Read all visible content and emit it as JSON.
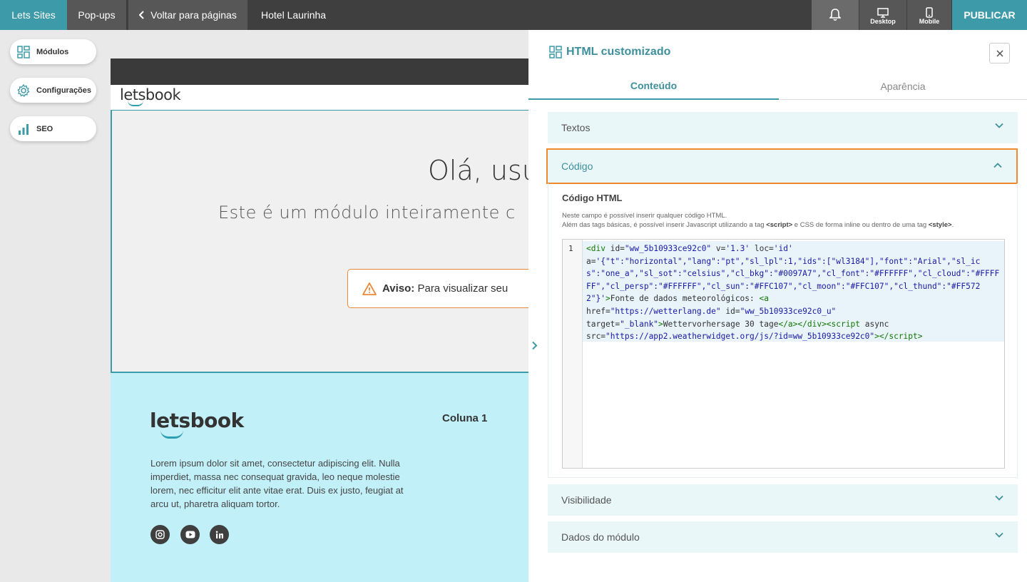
{
  "topbar": {
    "brand": "Lets Sites",
    "popups": "Pop-ups",
    "back": "Voltar para páginas",
    "page_name": "Hotel Laurinha",
    "desktop": "Desktop",
    "mobile": "Mobile",
    "publish": "PUBLICAR"
  },
  "sidebar": {
    "items": [
      {
        "label": "Módulos",
        "icon": "modules-icon"
      },
      {
        "label": "Configurações",
        "icon": "gear-icon"
      },
      {
        "label": "SEO",
        "icon": "bar-chart-icon"
      }
    ]
  },
  "preview": {
    "logo": "letsbook",
    "hero_title": "Olá, usu",
    "hero_subtitle": "Este é um módulo inteiramente c",
    "warning_label": "Aviso:",
    "warning_text": "Para visualizar seu",
    "footer_logo": "letsbook",
    "footer_column": "Coluna 1",
    "footer_text": "Lorem ipsum dolor sit amet, consectetur adipiscing elit. Nulla imperdiet, massa nec consequat gravida, leo neque molestie lorem, nec efficitur elit ante vitae erat. Duis ex justo, feugiat at arcu ut, pharetra aliquam tortor.",
    "social": [
      "instagram-icon",
      "youtube-icon",
      "linkedin-icon"
    ]
  },
  "panel": {
    "title": "HTML customizado",
    "tabs": [
      "Conteúdo",
      "Aparência"
    ],
    "sections": {
      "textos": "Textos",
      "codigo": "Código",
      "visibilidade": "Visibilidade",
      "dados": "Dados do módulo"
    },
    "code_block": {
      "title": "Código HTML",
      "desc_line1": "Neste campo é possível inserir qualquer código HTML.",
      "desc_line2_a": "Além das tags básicas, é possível inserir Javascript utilizando a tag ",
      "desc_script": "<script>",
      "desc_line2_b": " e CSS de forma inline ou dentro de uma tag ",
      "desc_style": "<style>",
      "desc_end": ".",
      "line_number": "1"
    }
  },
  "colors": {
    "accent": "#3d9aa8",
    "highlight_border": "#ef8b2c",
    "topbar": "#3f3f3f"
  }
}
